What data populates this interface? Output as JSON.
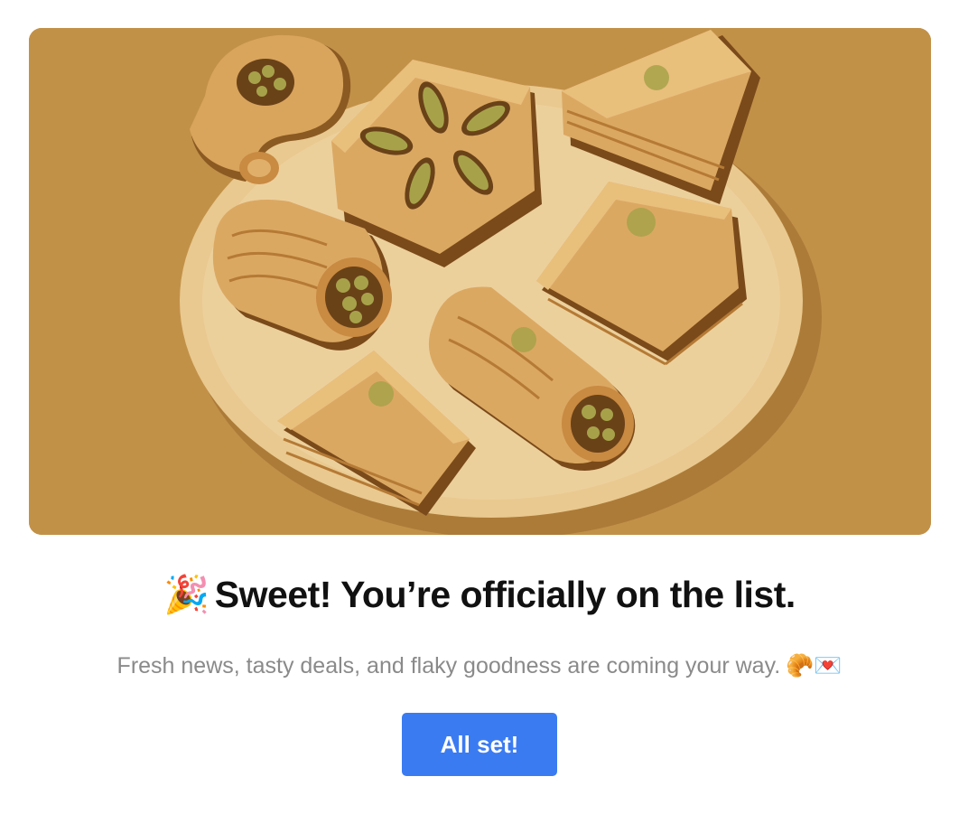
{
  "hero": {
    "alt": "Plate of assorted baklava pastries"
  },
  "confirmation": {
    "title_emoji": "🎉",
    "title": "Sweet! You’re officially on the list.",
    "subtitle": "Fresh news, tasty deals, and flaky goodness are coming your way.",
    "subtitle_emoji": "🥐💌"
  },
  "button": {
    "label": "All set!"
  },
  "colors": {
    "hero_background": "#c29148",
    "plate": "#e9c98f",
    "button": "#3b7bf2",
    "title": "#111111",
    "subtitle": "#8a8a8a"
  }
}
